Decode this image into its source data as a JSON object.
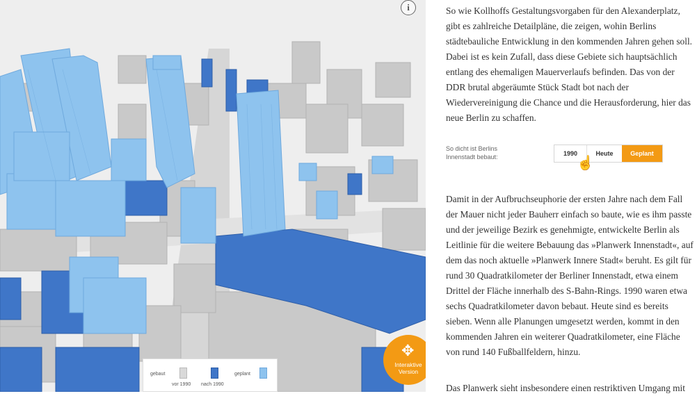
{
  "scene": {
    "info_icon": "info-icon",
    "legend": {
      "built_label": "gebaut",
      "planned_label": "geplant",
      "before_label": "vor 1990",
      "after_label": "nach 1990",
      "colors": {
        "before_1990": "#d9d9d9",
        "after_1990": "#3f76c8",
        "planned": "#8ec3ee"
      }
    },
    "interactive_button": {
      "icon": "move-icon",
      "line1": "Interaktive",
      "line2": "Version",
      "color": "#f39a14"
    }
  },
  "article": {
    "paragraph1": "So wie Kollhoffs Gestaltungsvorgaben für den Alexanderplatz, gibt es zahlreiche Detailpläne, die zeigen, wohin Berlins städtebauliche Entwicklung in den kommenden Jahren gehen soll. Dabei ist es kein Zufall, dass diese Gebiete sich hauptsächlich entlang des ehemaligen Mauerverlaufs befinden. Das von der DDR brutal abgeräumte Stück Stadt bot nach der Wiedervereinigung die Chance und die Herausforderung, hier das neue Berlin zu schaffen.",
    "density_control": {
      "label_line1": "So dicht ist Berlins",
      "label_line2": "Innenstadt bebaut:",
      "options": [
        "1990",
        "Heute",
        "Geplant"
      ],
      "selected": "Geplant",
      "pointer_icon": "hand-pointer-icon"
    },
    "paragraph2": "Damit in der Aufbruchseuphorie der ersten Jahre nach dem Fall der Mauer nicht jeder Bauherr einfach so baute, wie es ihm passte und der jeweilige Bezirk es genehmigte, entwickelte Berlin als Leitlinie für die weitere Bebauung das »Planwerk Innenstadt«, auf dem das noch aktuelle »Planwerk Innere Stadt« beruht. Es gilt für rund 30 Quadratkilometer der Berliner Innenstadt, etwa einem Drittel der Fläche innerhalb des S-Bahn-Rings. 1990 waren etwa sechs Quadratkilometer davon bebaut. Heute sind es bereits sieben. Wenn alle Planungen umgesetzt werden, kommt in den kommenden Jahren ein weiterer Quadratkilometer, eine Fläche von rund 140 Fußballfeldern, hinzu.",
    "paragraph3": "Das Planwerk sieht insbesondere einen restriktiven Umgang mit"
  }
}
